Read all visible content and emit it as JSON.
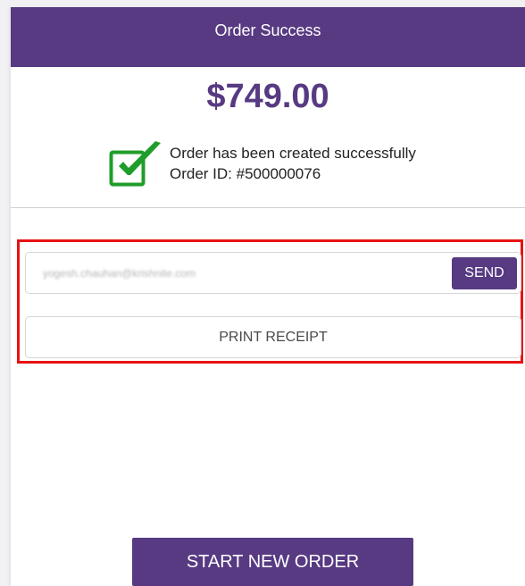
{
  "header": {
    "title": "Order Success"
  },
  "order": {
    "amount": "$749.00",
    "status_message": "Order has been created successfully",
    "order_id_text": "Order ID: #500000076"
  },
  "receipt": {
    "email_value": "yogesh.chauhan@krishnite.com",
    "send_label": "SEND",
    "print_label": "PRINT RECEIPT"
  },
  "footer": {
    "new_order_label": "START NEW ORDER"
  },
  "colors": {
    "brand_purple": "#573a82",
    "success_green": "#1f9d2a",
    "highlight_red": "#e81212"
  },
  "icons": {
    "status": "checkbox-checked-icon"
  }
}
